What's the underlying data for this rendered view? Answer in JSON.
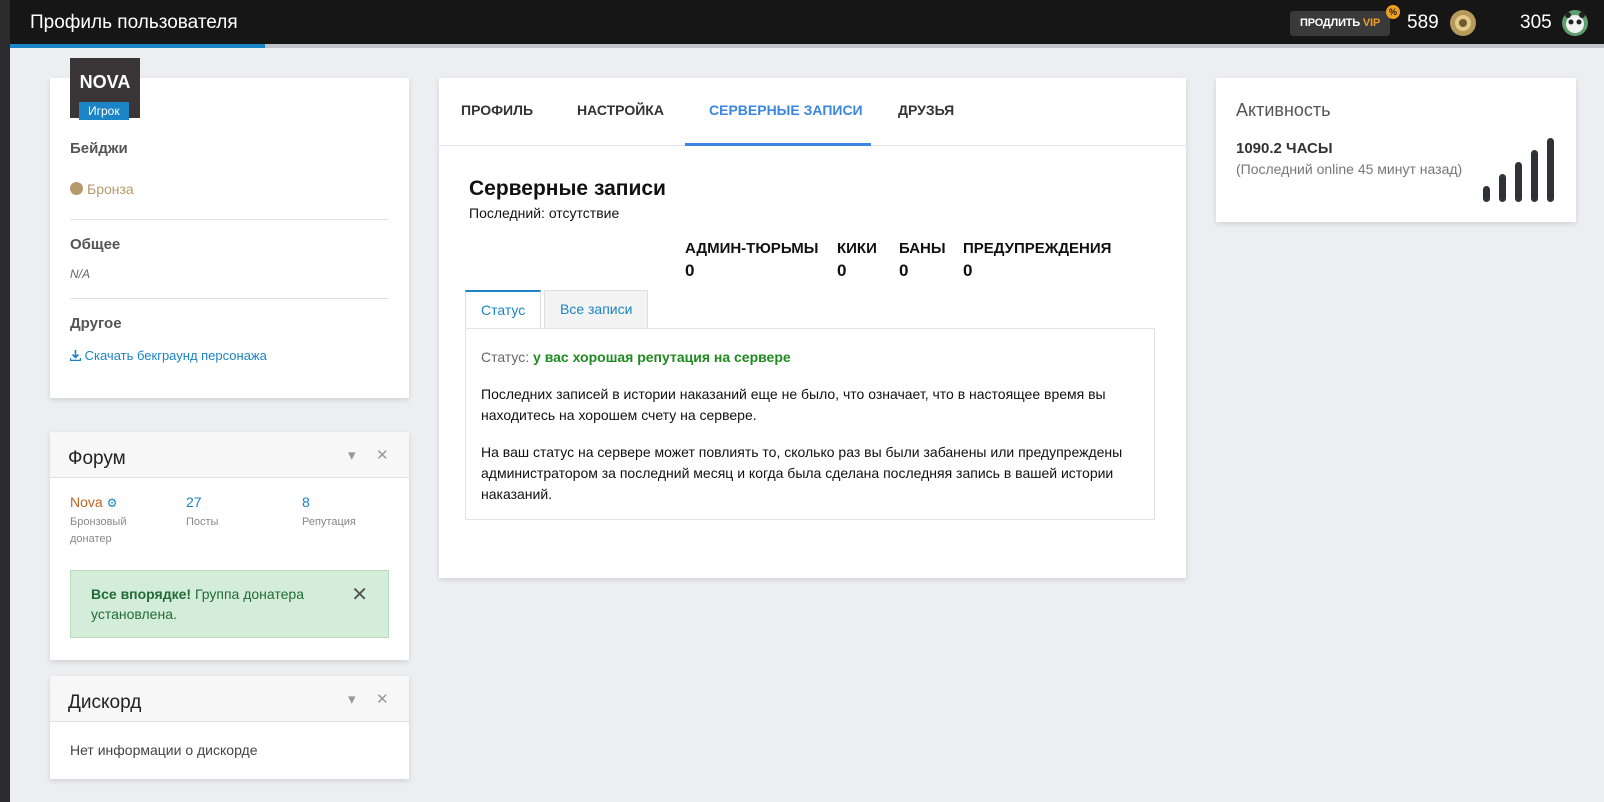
{
  "header": {
    "title": "Профиль пользователя",
    "progress_fraction": 0.16,
    "vip_button": {
      "label_prefix": "ПРОДЛИТЬ",
      "label_vip": "VIP"
    },
    "vip_badge": "%",
    "coins": [
      {
        "value": "589",
        "icon": "gold-medal-icon",
        "color": "#b5995d"
      },
      {
        "value": "305",
        "icon": "panda-mascot-icon",
        "color": "#5f9e6e"
      }
    ]
  },
  "profile": {
    "avatar_text": "NOVA",
    "role": "Игрок",
    "badges_title": "Бейджи",
    "badge": "Бронза",
    "general_title": "Общее",
    "general_value": "N/A",
    "other_title": "Другое",
    "download_link": "Скачать бекграунд персонажа"
  },
  "forum": {
    "title": "Форум",
    "user": "Nova",
    "user_rank": "Бронзовый донатер",
    "posts_value": "27",
    "posts_label": "Посты",
    "rep_value": "8",
    "rep_label": "Репутация",
    "alert_strong": "Все впорядке!",
    "alert_text": " Группа донатера установлена."
  },
  "discord": {
    "title": "Дискорд",
    "empty_text": "Нет информации о дискорде"
  },
  "main": {
    "tabs": [
      {
        "label": "ПРОФИЛЬ"
      },
      {
        "label": "НАСТРОЙКА"
      },
      {
        "label": "СЕРВЕРНЫЕ ЗАПИСИ"
      },
      {
        "label": "ДРУЗЬЯ"
      }
    ],
    "section_title": "Серверные записи",
    "last_record": "Последний: отсутствие",
    "stats": [
      {
        "label": "АДМИН-ТЮРЬМЫ",
        "value": "0"
      },
      {
        "label": "КИКИ",
        "value": "0"
      },
      {
        "label": "БАНЫ",
        "value": "0"
      },
      {
        "label": "ПРЕДУПРЕЖДЕНИЯ",
        "value": "0"
      }
    ],
    "subtabs": [
      {
        "label": "Статус"
      },
      {
        "label": "Все записи"
      }
    ],
    "status_label": "Статус: ",
    "status_value": "у вас хорошая репутация на сервере",
    "para1": "Последних записей в истории наказаний еще не было, что означает, что в настоящее время вы находитесь на хорошем счету на сервере.",
    "para2": "На ваш статус на сервере может повлиять то, сколько раз вы были забанены или предупреждены администратором за последний месяц и когда была сделана последняя запись в вашей истории наказаний."
  },
  "activity": {
    "title": "Активность",
    "hours": "1090.2 ЧАСЫ",
    "last_online": "(Последний online 45 минут назад)",
    "signal_level": 5
  }
}
